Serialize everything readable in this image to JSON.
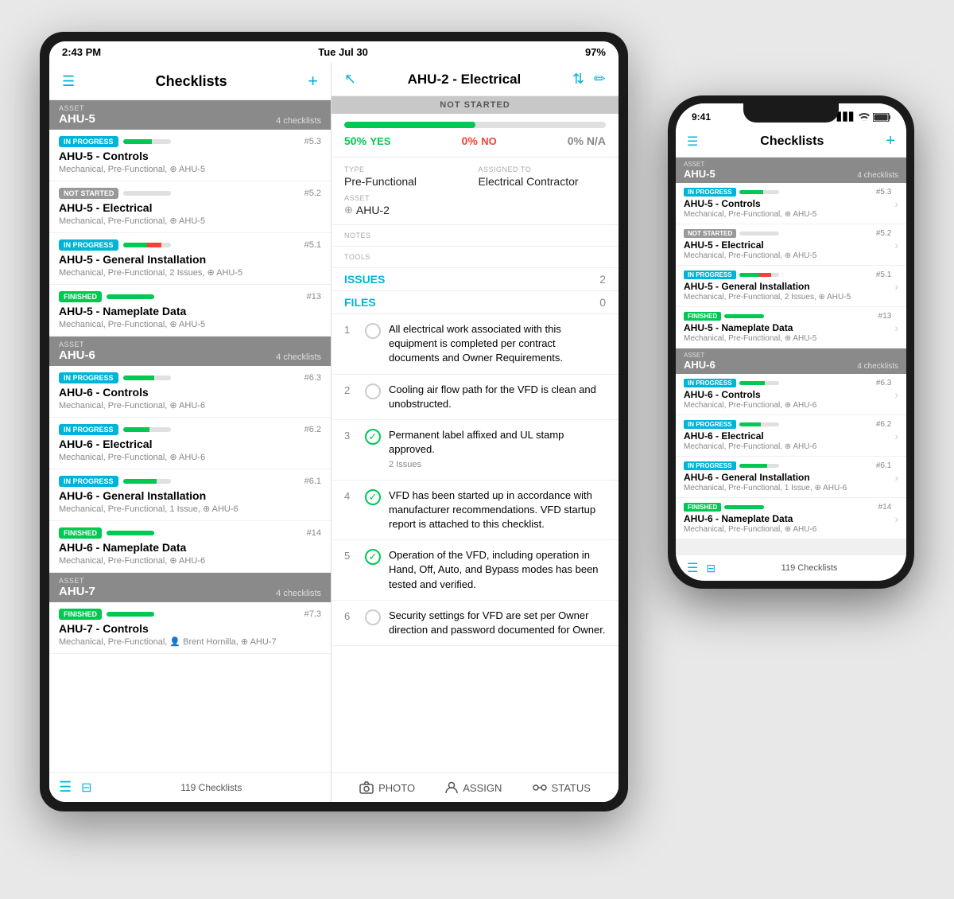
{
  "tablet": {
    "status_bar": {
      "time": "2:43 PM",
      "date": "Tue Jul 30",
      "wifi": "WiFi",
      "battery": "97%"
    },
    "left_panel": {
      "title": "Checklists",
      "footer_count": "119 Checklists",
      "asset_groups": [
        {
          "asset_label": "ASSET",
          "asset_name": "AHU-5",
          "asset_count": "4 checklists",
          "items": [
            {
              "status": "IN PROGRESS",
              "status_class": "badge-in-progress",
              "progress_green": 60,
              "progress_red": 0,
              "number": "#5.3",
              "title": "AHU-5 - Controls",
              "sub": "Mechanical, Pre-Functional, ⊕ AHU-5"
            },
            {
              "status": "NOT STARTED",
              "status_class": "badge-not-started",
              "progress_green": 0,
              "progress_red": 0,
              "number": "#5.2",
              "title": "AHU-5 - Electrical",
              "sub": "Mechanical, Pre-Functional, ⊕ AHU-5"
            },
            {
              "status": "IN PROGRESS",
              "status_class": "badge-in-progress",
              "progress_green": 50,
              "progress_red": 30,
              "number": "#5.1",
              "title": "AHU-5 - General Installation",
              "sub": "Mechanical, Pre-Functional, 2 Issues, ⊕ AHU-5"
            },
            {
              "status": "FINISHED",
              "status_class": "badge-finished",
              "progress_green": 100,
              "progress_red": 0,
              "number": "#13",
              "title": "AHU-5 - Nameplate Data",
              "sub": "Mechanical, Pre-Functional, ⊕ AHU-5"
            }
          ]
        },
        {
          "asset_label": "ASSET",
          "asset_name": "AHU-6",
          "asset_count": "4 checklists",
          "items": [
            {
              "status": "IN PROGRESS",
              "status_class": "badge-in-progress",
              "progress_green": 65,
              "progress_red": 0,
              "number": "#6.3",
              "title": "AHU-6 - Controls",
              "sub": "Mechanical, Pre-Functional, ⊕ AHU-6"
            },
            {
              "status": "IN PROGRESS",
              "status_class": "badge-in-progress",
              "progress_green": 55,
              "progress_red": 0,
              "number": "#6.2",
              "title": "AHU-6 - Electrical",
              "sub": "Mechanical, Pre-Functional, ⊕ AHU-6"
            },
            {
              "status": "IN PROGRESS",
              "status_class": "badge-in-progress",
              "progress_green": 70,
              "progress_red": 0,
              "number": "#6.1",
              "title": "AHU-6 - General Installation",
              "sub": "Mechanical, Pre-Functional, 1 Issue, ⊕ AHU-6"
            },
            {
              "status": "FINISHED",
              "status_class": "badge-finished",
              "progress_green": 100,
              "progress_red": 0,
              "number": "#14",
              "title": "AHU-6 - Nameplate Data",
              "sub": "Mechanical, Pre-Functional, ⊕ AHU-6"
            }
          ]
        },
        {
          "asset_label": "ASSET",
          "asset_name": "AHU-7",
          "asset_count": "4 checklists",
          "items": [
            {
              "status": "FINISHED",
              "status_class": "badge-finished",
              "progress_green": 100,
              "progress_red": 0,
              "number": "#7.3",
              "title": "AHU-7 - Controls",
              "sub": "Mechanical, Pre-Functional, 👤 Brent Hornilla, ⊕ AHU-7"
            }
          ]
        }
      ]
    },
    "right_panel": {
      "header_title": "AHU-2 - Electrical",
      "status_banner": "NOT STARTED",
      "progress_pct": 50,
      "stats": {
        "yes_pct": "50%",
        "yes_label": "YES",
        "no_pct": "0%",
        "no_label": "NO",
        "na_pct": "0% N/A"
      },
      "type_label": "TYPE",
      "type_value": "Pre-Functional",
      "assigned_label": "ASSIGNED TO",
      "assigned_value": "Electrical Contractor",
      "asset_label": "ASSET",
      "asset_value": "AHU-2",
      "notes_label": "NOTES",
      "tools_label": "TOOLS",
      "issues_label": "ISSUES",
      "issues_count": "2",
      "files_label": "FILES",
      "files_count": "0",
      "checklist_rows": [
        {
          "number": "1",
          "checked": false,
          "text": "All electrical work associated with this equipment is completed per contract documents and Owner Requirements.",
          "issue": ""
        },
        {
          "number": "2",
          "checked": false,
          "text": "Cooling air flow path for the VFD is clean and unobstructed.",
          "issue": ""
        },
        {
          "number": "3",
          "checked": true,
          "text": "Permanent label affixed and UL stamp approved.",
          "issue": "2 Issues"
        },
        {
          "number": "4",
          "checked": true,
          "text": "VFD has been started up in accordance with manufacturer recommendations. VFD startup report is attached to this checklist.",
          "issue": ""
        },
        {
          "number": "5",
          "checked": true,
          "text": "Operation of the VFD, including operation in Hand, Off, Auto, and Bypass modes has been tested and verified.",
          "issue": ""
        },
        {
          "number": "6",
          "checked": false,
          "text": "Security settings for VFD are set per Owner direction and password documented for Owner.",
          "issue": ""
        }
      ],
      "footer": {
        "photo": "PHOTO",
        "assign": "ASSIGN",
        "status": "STATUS"
      }
    }
  },
  "phone": {
    "status_bar": {
      "time": "9:41",
      "signal": "●●●",
      "wifi": "WiFi",
      "battery": "🔋"
    },
    "header_title": "Checklists",
    "footer_count": "119 Checklists",
    "asset_groups": [
      {
        "asset_label": "ASSET",
        "asset_name": "AHU-5",
        "asset_count": "4 checklists",
        "items": [
          {
            "status": "IN PROGRESS",
            "status_class": "badge-in-progress",
            "progress_green": 60,
            "progress_red": 0,
            "number": "#5.3",
            "title": "AHU-5 - Controls",
            "sub": "Mechanical, Pre-Functional, ⊕ AHU-5"
          },
          {
            "status": "NOT STARTED",
            "status_class": "badge-not-started",
            "progress_green": 0,
            "progress_red": 0,
            "number": "#5.2",
            "title": "AHU-5 - Electrical",
            "sub": "Mechanical, Pre-Functional, ⊕ AHU-5"
          },
          {
            "status": "IN PROGRESS",
            "status_class": "badge-in-progress",
            "progress_green": 50,
            "progress_red": 30,
            "number": "#5.1",
            "title": "AHU-5 - General Installation",
            "sub": "Mechanical, Pre-Functional, 2 Issues, ⊕ AHU-5"
          },
          {
            "status": "FINISHED",
            "status_class": "badge-finished",
            "progress_green": 100,
            "progress_red": 0,
            "number": "#13",
            "title": "AHU-5 - Nameplate Data",
            "sub": "Mechanical, Pre-Functional, ⊕ AHU-5"
          }
        ]
      },
      {
        "asset_label": "ASSET",
        "asset_name": "AHU-6",
        "asset_count": "4 checklists",
        "items": [
          {
            "status": "IN PROGRESS",
            "status_class": "badge-in-progress",
            "progress_green": 65,
            "progress_red": 0,
            "number": "#6.3",
            "title": "AHU-6 - Controls",
            "sub": "Mechanical, Pre-Functional, ⊕ AHU-6"
          },
          {
            "status": "IN PROGRESS",
            "status_class": "badge-in-progress",
            "progress_green": 55,
            "progress_red": 0,
            "number": "#6.2",
            "title": "AHU-6 - Electrical",
            "sub": "Mechanical, Pre-Functional, ⊕ AHU-6"
          },
          {
            "status": "IN PROGRESS",
            "status_class": "badge-in-progress",
            "progress_green": 70,
            "progress_red": 0,
            "number": "#6.1",
            "title": "AHU-6 - General Installation",
            "sub": "Mechanical, Pre-Functional, 1 Issue, ⊕ AHU-6"
          },
          {
            "status": "FINISHED",
            "status_class": "badge-finished",
            "progress_green": 100,
            "progress_red": 0,
            "number": "#14",
            "title": "AHU-6 - Nameplate Data",
            "sub": "Mechanical, Pre-Functional, ⊕ AHU-6"
          }
        ]
      }
    ]
  }
}
